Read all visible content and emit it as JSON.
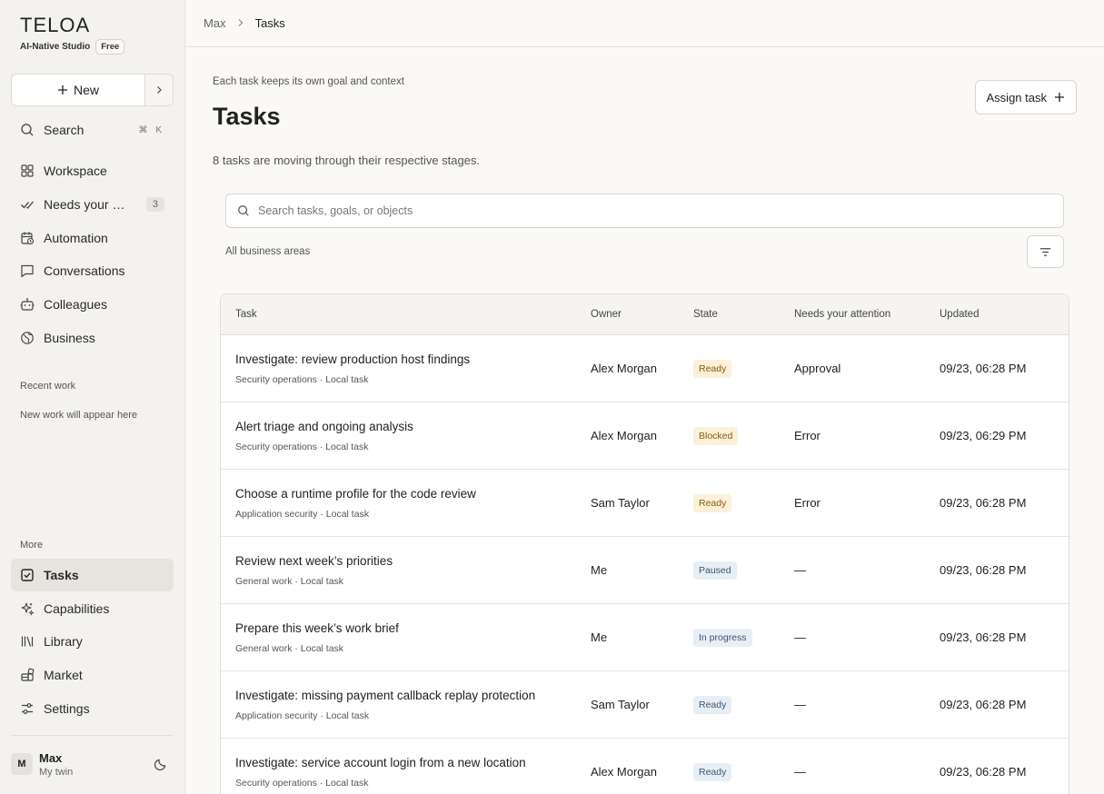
{
  "brand": {
    "name": "TELOA",
    "subtitle": "AI-Native Studio",
    "plan": "Free"
  },
  "sidebar": {
    "new_label": "New",
    "search_label": "Search",
    "search_shortcut": "⌘ K",
    "primary_items": [
      {
        "label": "Workspace",
        "icon": "grid-icon"
      },
      {
        "label": "Needs your attention",
        "icon": "check-double-icon",
        "count": "3"
      },
      {
        "label": "Automation",
        "icon": "calendar-clock-icon"
      },
      {
        "label": "Conversations",
        "icon": "chat-icon"
      },
      {
        "label": "Colleagues",
        "icon": "bot-icon"
      },
      {
        "label": "Business",
        "icon": "globe-icon"
      }
    ],
    "recent_label": "Recent work",
    "recent_empty": "New work will appear here",
    "more_label": "More",
    "secondary_items": [
      {
        "label": "Tasks",
        "icon": "check-square-icon",
        "active": true
      },
      {
        "label": "Capabilities",
        "icon": "sparkles-icon"
      },
      {
        "label": "Library",
        "icon": "library-icon"
      },
      {
        "label": "Market",
        "icon": "blocks-icon"
      },
      {
        "label": "Settings",
        "icon": "sliders-icon"
      }
    ],
    "profile": {
      "initial": "M",
      "name": "Max",
      "sub": "My twin"
    }
  },
  "breadcrumb": {
    "root": "Max",
    "current": "Tasks"
  },
  "page": {
    "eyebrow": "Each task keeps its own goal and context",
    "title": "Tasks",
    "assign_label": "Assign task",
    "summary": "8 tasks are moving through their respective stages.",
    "search_placeholder": "Search tasks, goals, or objects",
    "areas_label": "All business areas"
  },
  "table": {
    "headers": {
      "task": "Task",
      "owner": "Owner",
      "state": "State",
      "attention": "Needs your attention",
      "updated": "Updated"
    },
    "rows": [
      {
        "title": "Investigate: review production host findings",
        "meta": "Security operations · Local task",
        "owner": "Alex Morgan",
        "state": "Ready",
        "tone": "warm",
        "attention": "Approval",
        "updated": "09/23, 06:28 PM"
      },
      {
        "title": "Alert triage and ongoing analysis",
        "meta": "Security operations · Local task",
        "owner": "Alex Morgan",
        "state": "Blocked",
        "tone": "warm",
        "attention": "Error",
        "updated": "09/23, 06:29 PM"
      },
      {
        "title": "Choose a runtime profile for the code review",
        "meta": "Application security · Local task",
        "owner": "Sam Taylor",
        "state": "Ready",
        "tone": "warm",
        "attention": "Error",
        "updated": "09/23, 06:28 PM"
      },
      {
        "title": "Review next week’s priorities",
        "meta": "General work · Local task",
        "owner": "Me",
        "state": "Paused",
        "tone": "cool",
        "attention": "—",
        "updated": "09/23, 06:28 PM"
      },
      {
        "title": "Prepare this week’s work brief",
        "meta": "General work · Local task",
        "owner": "Me",
        "state": "In progress",
        "tone": "cool",
        "attention": "—",
        "updated": "09/23, 06:28 PM"
      },
      {
        "title": "Investigate: missing payment callback replay protection",
        "meta": "Application security · Local task",
        "owner": "Sam Taylor",
        "state": "Ready",
        "tone": "cool",
        "attention": "—",
        "updated": "09/23, 06:28 PM"
      },
      {
        "title": "Investigate: service account login from a new location",
        "meta": "Security operations · Local task",
        "owner": "Alex Morgan",
        "state": "Ready",
        "tone": "cool",
        "attention": "—",
        "updated": "09/23, 06:28 PM"
      }
    ]
  }
}
